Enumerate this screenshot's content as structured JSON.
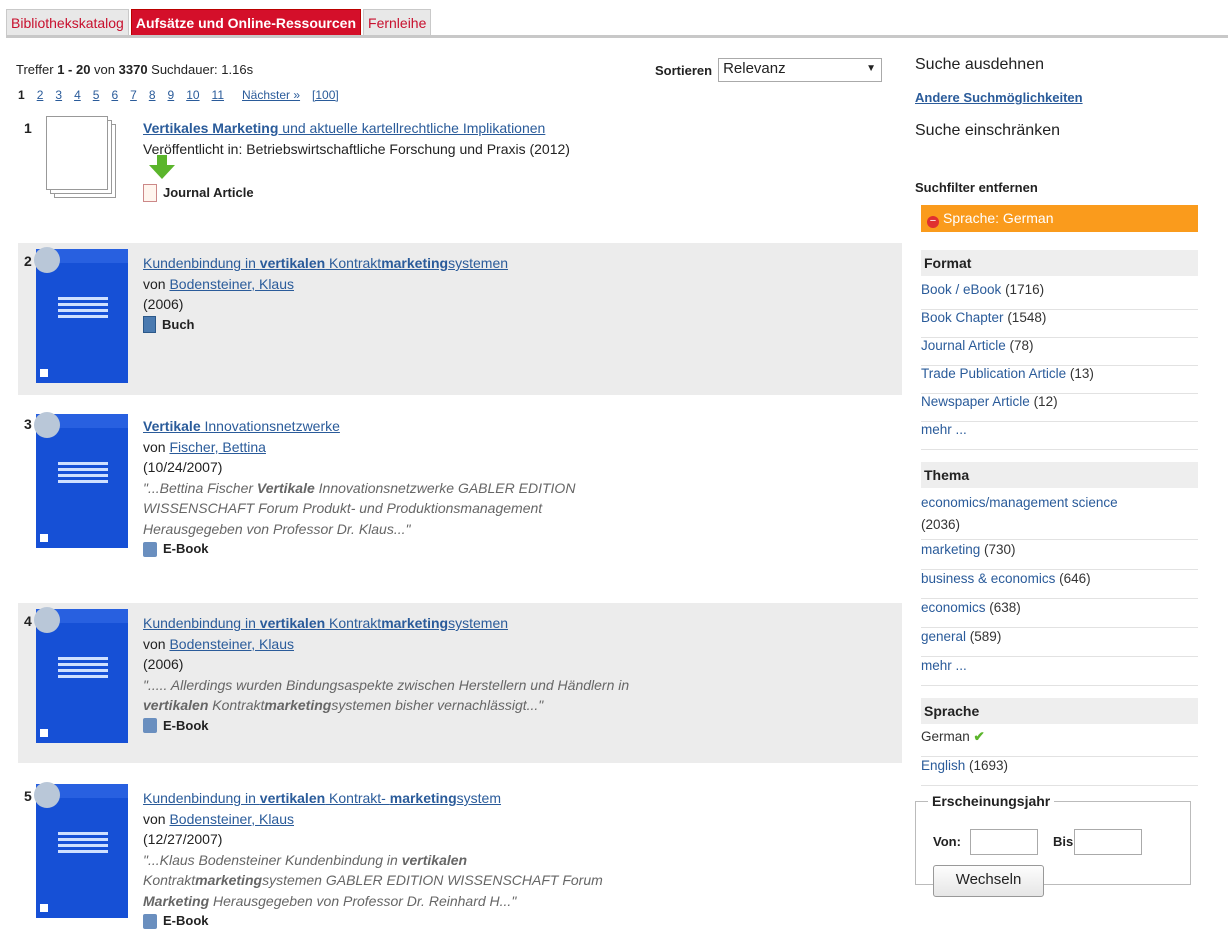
{
  "tabs": [
    "Bibliothekskatalog",
    "Aufsätze und Online-Ressourcen",
    "Fernleihe"
  ],
  "stats": {
    "prefix": "Treffer ",
    "range": "1 - 20",
    "of": " von ",
    "total": "3370",
    "duration": " Suchdauer: 1.16s"
  },
  "pager": {
    "current": "1",
    "pages": [
      "2",
      "3",
      "4",
      "5",
      "6",
      "7",
      "8",
      "9",
      "10",
      "11"
    ],
    "next": "Nächster »",
    "last": "[100]"
  },
  "sort": {
    "label": "Sortieren",
    "value": "Relevanz"
  },
  "results": [
    {
      "num": "1",
      "title_pre": "",
      "title_b1": "Vertikales Marketing",
      "title_mid": " und aktuelle kartellrechtliche Implikationen",
      "title_b2": "",
      "title_post": "",
      "line2": "Veröffentlicht in: Betriebswirtschaftliche Forschung und Praxis (2012)",
      "format": "Journal Article"
    },
    {
      "num": "2",
      "title_pre": "Kundenbindung in ",
      "title_b1": "vertikalen",
      "title_mid": " Kontrakt",
      "title_b2": "marketing",
      "title_post": "systemen",
      "by": "von ",
      "author": "Bodensteiner, Klaus",
      "date": "(2006)",
      "format": "Buch"
    },
    {
      "num": "3",
      "title_pre": "",
      "title_b1": "Vertikale",
      "title_mid": " Innovationsnetzwerke",
      "title_b2": "",
      "title_post": "",
      "by": "von ",
      "author": "Fischer, Bettina",
      "date": "(10/24/2007)",
      "snippet1a": "\"...Bettina Fischer ",
      "snippet1b": "Vertikale",
      "snippet1c": " Innovationsnetzwerke GABLER EDITION",
      "snippet2": "WISSENSCHAFT Forum Produkt- und Produktionsmanagement",
      "snippet3": "Herausgegeben von Professor Dr. Klaus...\"",
      "format": "E-Book"
    },
    {
      "num": "4",
      "title_pre": "Kundenbindung in ",
      "title_b1": "vertikalen",
      "title_mid": " Kontrakt",
      "title_b2": "marketing",
      "title_post": "systemen",
      "by": "von ",
      "author": "Bodensteiner, Klaus",
      "date": "(2006)",
      "snippet1": "\"..... Allerdings wurden Bindungsaspekte zwischen Herstellern und Händlern in",
      "snippet2a": "vertikalen",
      "snippet2b": " Kontrakt",
      "snippet2c": "marketing",
      "snippet2d": "systemen bisher vernachlässigt...\"",
      "format": "E-Book"
    },
    {
      "num": "5",
      "title_pre": "Kundenbindung in ",
      "title_b1": "vertikalen",
      "title_mid": " Kontrakt- ",
      "title_b2": "marketing",
      "title_post": "system",
      "by": "von ",
      "author": "Bodensteiner, Klaus",
      "date": "(12/27/2007)",
      "snippet1a": "\"...Klaus Bodensteiner Kundenbindung in ",
      "snippet1b": "vertikalen",
      "snippet2a": "Kontrakt",
      "snippet2b": "marketing",
      "snippet2c": "systemen GABLER EDITION WISSENSCHAFT Forum",
      "snippet3a": "Marketing",
      "snippet3b": " Herausgegeben von Professor Dr. Reinhard H...\"",
      "format": "E-Book"
    }
  ],
  "side": {
    "expand": "Suche ausdehnen",
    "other": "Andere Suchmöglichkeiten",
    "narrow": "Suche einschränken",
    "remove": "Suchfilter entfernen",
    "active_filter": "Sprache: German",
    "format_hdr": "Format",
    "formats": [
      {
        "label": "Book / eBook",
        "count": " (1716)"
      },
      {
        "label": "Book Chapter",
        "count": " (1548)"
      },
      {
        "label": "Journal Article",
        "count": " (78)"
      },
      {
        "label": "Trade Publication Article",
        "count": " (13)"
      },
      {
        "label": "Newspaper Article",
        "count": " (12)"
      }
    ],
    "more": "mehr ...",
    "topic_hdr": "Thema",
    "topics": [
      {
        "label": "economics/management science",
        "count": "(2036)"
      },
      {
        "label": "marketing",
        "count": " (730)"
      },
      {
        "label": "business & economics",
        "count": " (646)"
      },
      {
        "label": "economics",
        "count": " (638)"
      },
      {
        "label": "general",
        "count": " (589)"
      }
    ],
    "lang_hdr": "Sprache",
    "lang_selected": "German",
    "lang_other": {
      "label": "English",
      "count": " (1693)"
    },
    "year_legend": "Erscheinungsjahr",
    "from": "Von:",
    "to": "Bis:",
    "apply": "Wechseln"
  },
  "colors": {
    "accent": "#d40f2a",
    "link": "#2a5b9a",
    "filter": "#fa9b1c",
    "cover": "#1650d6"
  }
}
